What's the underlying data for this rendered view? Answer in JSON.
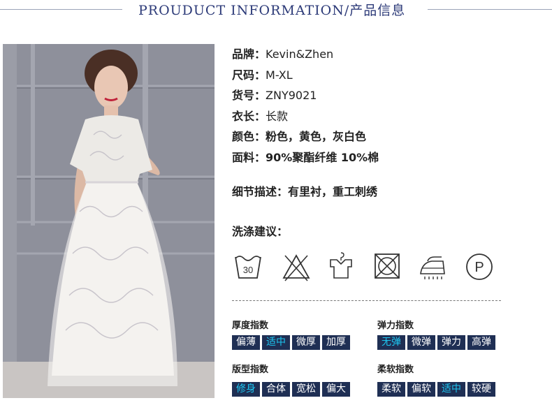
{
  "header": {
    "title": "PROUDUCT INFORMATION/产品信息"
  },
  "product": {
    "brand_label": "品牌：",
    "brand": "Kevin&Zhen",
    "size_label": "尺码：",
    "size": "M-XL",
    "sku_label": "货号：",
    "sku": "ZNY9021",
    "length_label": "衣长：",
    "length": "长款",
    "color_label": "颜色：",
    "color": "粉色，黄色，灰白色",
    "fabric_label": "面料：",
    "fabric": "90%聚酯纤维 10%棉",
    "detail_label": "细节描述：",
    "detail": "有里衬，重工刺绣",
    "wash_label": "洗涤建议："
  },
  "care": {
    "wash_temp": "30",
    "dryclean_letter": "P"
  },
  "indices": {
    "thickness": {
      "title": "厚度指数",
      "options": [
        "偏薄",
        "适中",
        "微厚",
        "加厚"
      ],
      "selected": "适中"
    },
    "elasticity": {
      "title": "弹力指数",
      "options": [
        "无弹",
        "微弹",
        "弹力",
        "高弹"
      ],
      "selected": "无弹"
    },
    "fit": {
      "title": "版型指数",
      "options": [
        "修身",
        "合体",
        "宽松",
        "偏大"
      ],
      "selected": "修身"
    },
    "softness": {
      "title": "柔软指数",
      "options": [
        "柔软",
        "偏软",
        "适中",
        "较硬"
      ],
      "selected": "适中"
    }
  },
  "colors": {
    "navy": "#1f2f54",
    "highlight": "#1ec6f0",
    "header": "#2c3a78"
  }
}
